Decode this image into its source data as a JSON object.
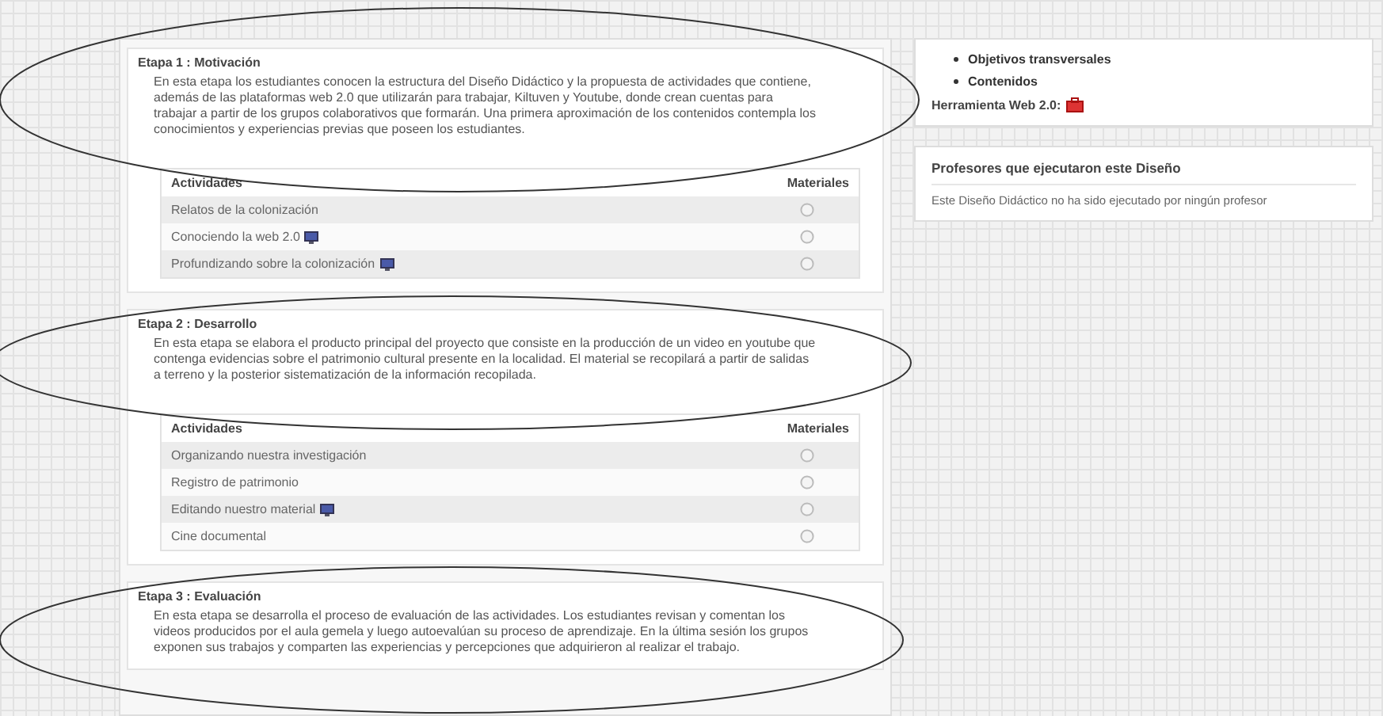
{
  "stages": [
    {
      "title": "Etapa 1 : Motivación",
      "description": "En esta etapa los estudiantes conocen la estructura del Diseño Didáctico y la propuesta de actividades que contiene, además de las plataformas web 2.0 que utilizarán para trabajar, Kiltuven y Youtube, donde crean cuentas para trabajar a partir de los grupos colaborativos que formarán. Una primera aproximación de los contenidos contempla los conocimientos y experiencias previas que poseen los estudiantes.",
      "table": {
        "columns": [
          "Actividades",
          "Materiales"
        ],
        "rows": [
          {
            "name": "Relatos de la colonización",
            "attachment": false
          },
          {
            "name": "Conociendo la web 2.0",
            "attachment": true
          },
          {
            "name": "Profundizando sobre la colonización",
            "attachment": true
          }
        ]
      }
    },
    {
      "title": "Etapa 2 : Desarrollo",
      "description": "En esta etapa se elabora el producto principal del proyecto que consiste en la producción de un video en youtube que contenga evidencias sobre el patrimonio cultural presente en la localidad. El material se recopilará a partir de salidas a terreno y la posterior sistematización de la información recopilada.",
      "table": {
        "columns": [
          "Actividades",
          "Materiales"
        ],
        "rows": [
          {
            "name": "Organizando nuestra investigación",
            "attachment": false
          },
          {
            "name": "Registro de patrimonio",
            "attachment": false
          },
          {
            "name": "Editando nuestro material",
            "attachment": true
          },
          {
            "name": "Cine documental",
            "attachment": false
          }
        ]
      }
    },
    {
      "title": "Etapa 3 : Evaluación",
      "description": "En esta etapa se desarrolla el proceso de evaluación de las actividades. Los estudiantes revisan y comentan los videos producidos por el aula gemela y luego autoevalúan su proceso de aprendizaje. En la última sesión los grupos exponen sus trabajos y comparten las experiencias y percepciones que adquirieron al realizar el trabajo."
    }
  ],
  "sidebar": {
    "links": [
      "Objetivos transversales",
      "Contenidos"
    ],
    "tool_label": "Herramienta Web 2.0:",
    "teachers": {
      "title": "Profesores que ejecutaron este Diseño",
      "text": "Este Diseño Didáctico no ha sido ejecutado por ningún profesor"
    }
  }
}
